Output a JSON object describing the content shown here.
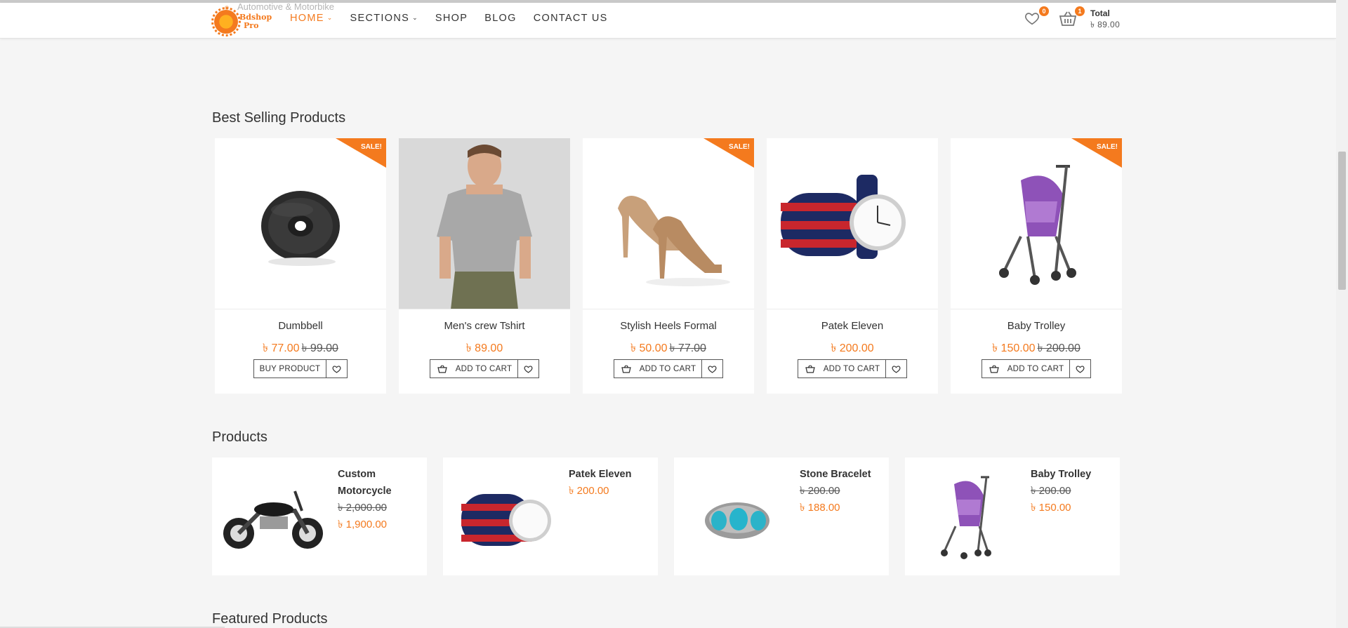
{
  "header": {
    "ghost_text": "Automotive & Motorbike",
    "logo_text": [
      "Bdshop",
      "Pro"
    ],
    "nav": [
      {
        "label": "HOME",
        "has_chevron": true,
        "active": true
      },
      {
        "label": "SECTIONS",
        "has_chevron": true,
        "active": false
      },
      {
        "label": "SHOP",
        "has_chevron": false,
        "active": false
      },
      {
        "label": "BLOG",
        "has_chevron": false,
        "active": false
      },
      {
        "label": "CONTACT US",
        "has_chevron": false,
        "active": false
      }
    ],
    "wishlist_count": "0",
    "cart_count": "1",
    "total_label": "Total",
    "total_value": "৳ 89.00"
  },
  "best_selling": {
    "title": "Best Selling Products",
    "sale_label": "SALE!",
    "products": [
      {
        "name": "Dumbbell",
        "price": "৳ 77.00",
        "old_price": "৳ 99.00",
        "sale": true,
        "button": "BUY PRODUCT",
        "button_icon": false,
        "image": "dumbbell"
      },
      {
        "name": "Men's crew Tshirt",
        "price": "৳ 89.00",
        "old_price": "",
        "sale": false,
        "button": "ADD TO CART",
        "button_icon": true,
        "image": "tshirt"
      },
      {
        "name": "Stylish Heels Formal",
        "price": "৳ 50.00",
        "old_price": "৳ 77.00",
        "sale": true,
        "button": "ADD TO CART",
        "button_icon": true,
        "image": "heels"
      },
      {
        "name": "Patek Eleven",
        "price": "৳ 200.00",
        "old_price": "",
        "sale": false,
        "button": "ADD TO CART",
        "button_icon": true,
        "image": "watch"
      },
      {
        "name": "Baby Trolley",
        "price": "৳ 150.00",
        "old_price": "৳ 200.00",
        "sale": true,
        "button": "ADD TO CART",
        "button_icon": true,
        "image": "trolley"
      }
    ]
  },
  "products": {
    "title": "Products",
    "items": [
      {
        "name": "Custom Motorcycle",
        "old_price": "৳ 2,000.00",
        "price": "৳ 1,900.00",
        "image": "motorcycle"
      },
      {
        "name": "Patek Eleven",
        "old_price": "",
        "price": "৳ 200.00",
        "image": "watch"
      },
      {
        "name": "Stone Bracelet",
        "old_price": "৳ 200.00",
        "price": "৳ 188.00",
        "image": "bracelet"
      },
      {
        "name": "Baby Trolley",
        "old_price": "৳ 200.00",
        "price": "৳ 150.00",
        "image": "trolley"
      }
    ]
  },
  "featured": {
    "title": "Featured Products"
  },
  "colors": {
    "accent": "#f47a1e",
    "background": "#f5f5f5"
  }
}
